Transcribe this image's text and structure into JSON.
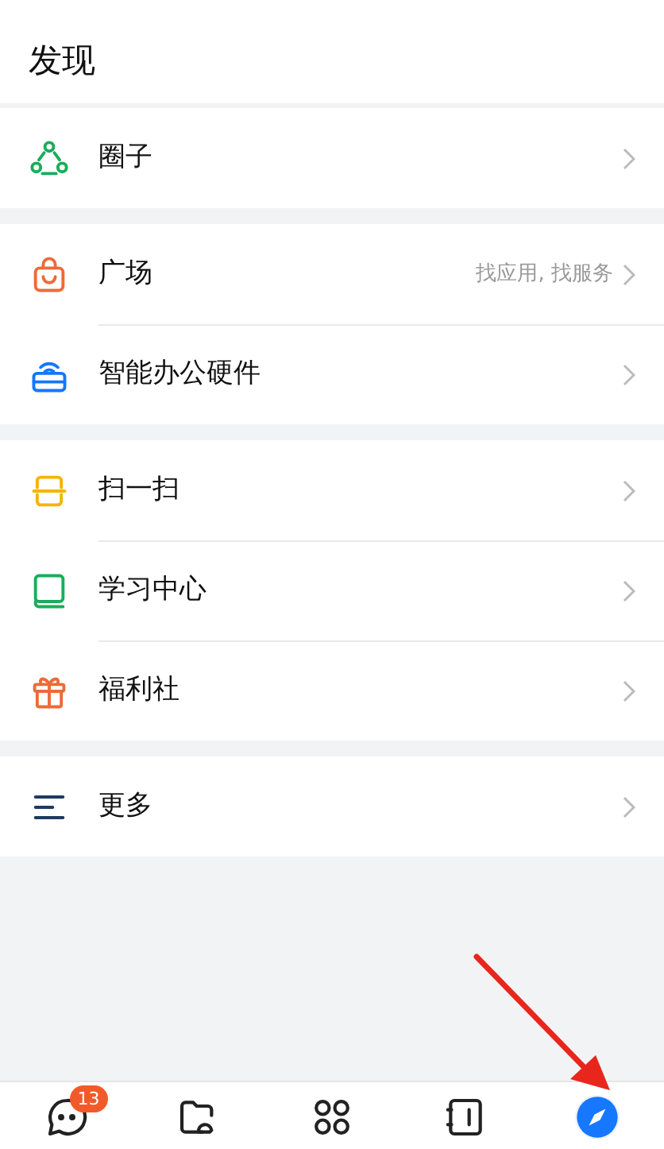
{
  "header": {
    "title": "发现"
  },
  "groups": [
    {
      "items": [
        {
          "label": "圈子"
        }
      ]
    },
    {
      "items": [
        {
          "label": "广场",
          "hint": "找应用, 找服务"
        },
        {
          "label": "智能办公硬件"
        }
      ]
    },
    {
      "items": [
        {
          "label": "扫一扫"
        },
        {
          "label": "学习中心"
        },
        {
          "label": "福利社"
        }
      ]
    },
    {
      "items": [
        {
          "label": "更多"
        }
      ]
    }
  ],
  "tab_bar": [
    {
      "badge": "13",
      "selected": false
    },
    {
      "selected": false
    },
    {
      "selected": false
    },
    {
      "selected": false
    },
    {
      "selected": true
    }
  ]
}
